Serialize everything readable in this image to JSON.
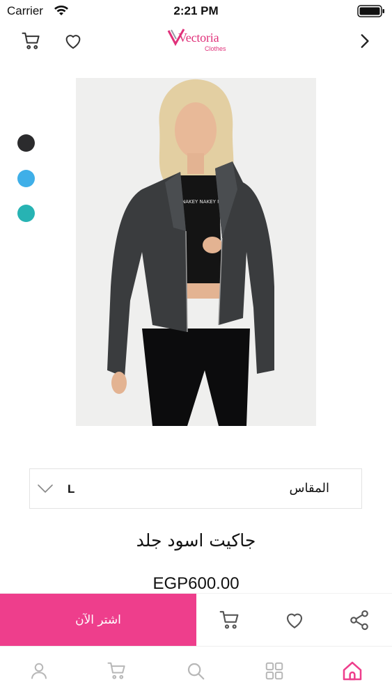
{
  "status_bar": {
    "carrier": "Carrier",
    "time": "2:21 PM"
  },
  "header": {
    "logo_text": "Vectoria",
    "logo_subtext": "Clothes",
    "icons": [
      "cart-icon",
      "heart-icon",
      "chevron-right-icon"
    ]
  },
  "product": {
    "image_alt": "Model wearing black leather jacket",
    "colors": [
      "#2b2b2d",
      "#3fafe8",
      "#27b3b3"
    ],
    "size_label": "المقاس",
    "size_value": "L",
    "title": "جاكيت اسود جلد",
    "price": "EGP600.00"
  },
  "actions": {
    "buy_now": "اشتر الآن",
    "icons": [
      "cart-icon",
      "heart-icon",
      "share-icon"
    ]
  },
  "tab_bar": {
    "tabs": [
      "profile-icon",
      "cart-icon",
      "search-icon",
      "grid-icon",
      "home-icon"
    ],
    "active": "home-icon"
  },
  "theme": {
    "accent": "#ee3e8c",
    "brand": "#e0317a",
    "icon_color": "#666666",
    "tab_inactive": "#b7b7b7"
  }
}
